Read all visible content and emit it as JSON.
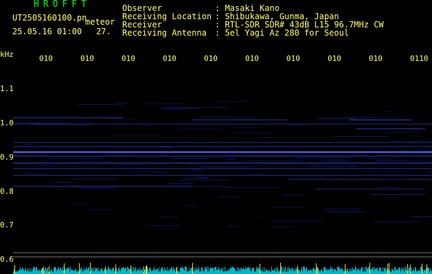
{
  "header": {
    "brand": "HROFFT",
    "filename": "UT2505160100.pn",
    "mode": "meteor",
    "datetime": "25.05.16 01:00",
    "count": "27."
  },
  "info": [
    {
      "label": "Observer",
      "value": ": Masaki Kano"
    },
    {
      "label": "Receiving Location",
      "value": ": Shibukawa, Gunma, Japan"
    },
    {
      "label": "Receiver",
      "value": ": RTL-SDR SDR# 43dB L15 96.7MHz CW"
    },
    {
      "label": "Receiving Antenna",
      "value": ": 5el Yagi Az 280 for Seoul"
    }
  ],
  "axis": {
    "freq_unit": "kHz",
    "freq_labels": [
      "1.1",
      "1.0",
      "0.9",
      "0.8",
      "0.7",
      "0.6"
    ],
    "time_labels": [
      "010",
      "010",
      "010",
      "010",
      "010",
      "010",
      "010",
      "010",
      "010",
      "0110"
    ]
  },
  "colors": {
    "background": "#000000",
    "text": "#ffff66",
    "brand": "#00ff00",
    "signal": "#3355ff",
    "baseline": "#00ccdd",
    "spike": "#ffff33"
  }
}
